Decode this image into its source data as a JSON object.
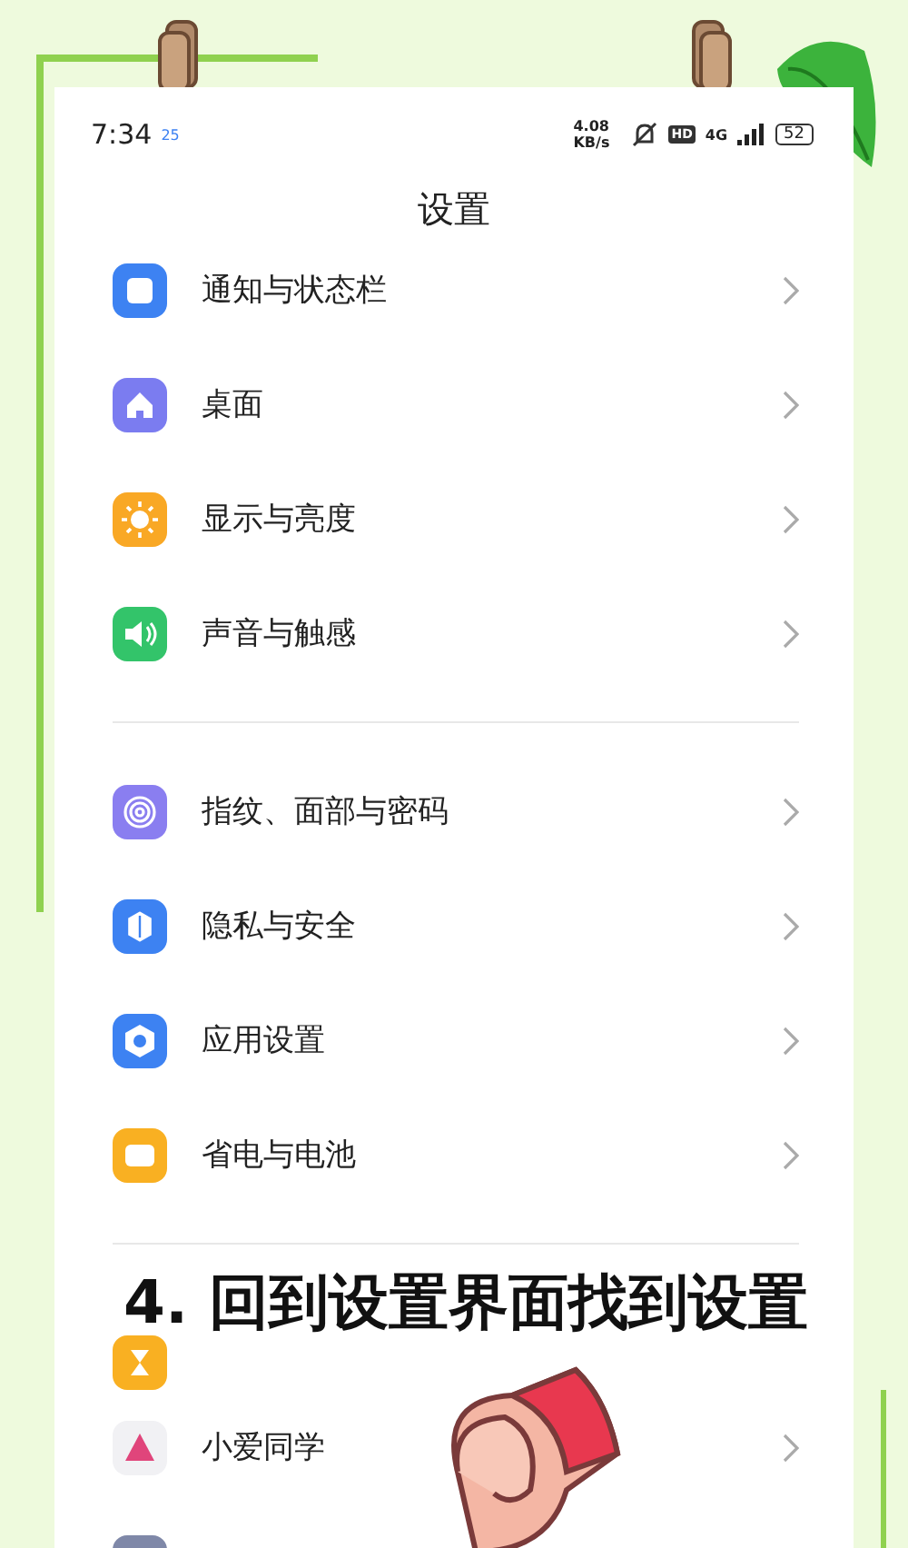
{
  "status_bar": {
    "time": "7:34",
    "badge": "25",
    "speed": "4.08 KB/s",
    "hd": "HD",
    "network": "4G",
    "battery": "52"
  },
  "title": "设置",
  "sections": [
    {
      "items": [
        {
          "kind": "row",
          "label": "通知与状态栏"
        },
        {
          "kind": "row",
          "label": "桌面"
        },
        {
          "kind": "row",
          "label": "显示与亮度"
        },
        {
          "kind": "row",
          "label": "声音与触感"
        }
      ]
    },
    {
      "items": [
        {
          "kind": "row",
          "label": "指纹、面部与密码"
        },
        {
          "kind": "row",
          "label": "隐私与安全"
        },
        {
          "kind": "row",
          "label": "应用设置"
        },
        {
          "kind": "row",
          "label": "省电与电池"
        }
      ]
    },
    {
      "items": [
        {
          "kind": "icon_only"
        },
        {
          "kind": "row",
          "label": "小爱同学"
        },
        {
          "kind": "icon_only"
        }
      ]
    }
  ],
  "caption": "4. 回到设置界面找到设置"
}
